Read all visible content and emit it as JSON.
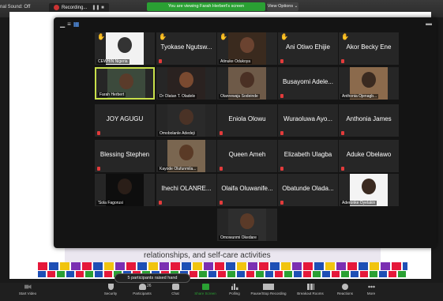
{
  "top": {
    "audio": "nal Sound: Off",
    "recording": "Recording...",
    "recording_controls": "❚❚ ■",
    "viewing_banner": "You are viewing Farah Herbert's screen",
    "view_options": "View Options ⌄"
  },
  "slide": {
    "text": "relationships, and self-care activities"
  },
  "participants": [
    {
      "name": "CEWHIN Nigeria",
      "hand": true,
      "video": true
    },
    {
      "name": "Tyokase Ngutsw...",
      "hand": true,
      "video": false
    },
    {
      "name": "Atinuke Odukoya",
      "hand": true,
      "video": true
    },
    {
      "name": "Ani Otiwo Ehijie",
      "hand": true,
      "video": false
    },
    {
      "name": "Akor Becky Ene",
      "hand": true,
      "video": false
    },
    {
      "name": "Farah Herbert",
      "hand": false,
      "video": true
    },
    {
      "name": "Dr Olatan T. Oladele",
      "hand": false,
      "video": true
    },
    {
      "name": "Olanrewaju Sodeinde",
      "hand": false,
      "video": true
    },
    {
      "name": "Busayomi Adele...",
      "hand": false,
      "video": false
    },
    {
      "name": "Anthonia Ojenagb...",
      "hand": false,
      "video": true
    },
    {
      "name": "JOY AGUGU",
      "hand": false,
      "video": false
    },
    {
      "name": "Omobolanle Adedeji",
      "hand": false,
      "video": true
    },
    {
      "name": "Eniola Olowu",
      "hand": false,
      "video": false
    },
    {
      "name": "Wuraoluwa Ayo...",
      "hand": false,
      "video": false
    },
    {
      "name": "Anthonia James",
      "hand": false,
      "video": false
    },
    {
      "name": "Blessing Stephen",
      "hand": false,
      "video": false
    },
    {
      "name": "Kayode Olufunmila...",
      "hand": false,
      "video": true
    },
    {
      "name": "Queen Ameh",
      "hand": false,
      "video": false
    },
    {
      "name": "Elizabeth Ulagba",
      "hand": false,
      "video": false
    },
    {
      "name": "Aduke Obelawo",
      "hand": false,
      "video": false
    },
    {
      "name": "'Sola Fagorusi",
      "hand": false,
      "video": true
    },
    {
      "name": "Ihechi OLANRE...",
      "hand": false,
      "video": false
    },
    {
      "name": "Olaifa Oluwanife...",
      "hand": false,
      "video": false
    },
    {
      "name": "Obatunde Olada...",
      "hand": false,
      "video": false
    },
    {
      "name": "Aderonke Oyelakin",
      "hand": false,
      "video": true
    },
    {
      "name": "Omowunmi Okedare",
      "hand": false,
      "video": true
    }
  ],
  "raised_notice": "5 participants raised hand",
  "toolbar": {
    "start_video": "Start Video",
    "security": "Security",
    "participants": "Participants",
    "participants_count": "26",
    "chat": "Chat",
    "share_screen": "Share Screen",
    "polling": "Polling",
    "recording": "Pause/Stop Recording",
    "breakout": "Breakout Rooms",
    "reactions": "Reactions",
    "more": "More"
  },
  "colors": {
    "accent_green": "#2aa033",
    "active_speaker": "#c8e04a",
    "muted_red": "#e23b3b",
    "hand_yellow": "#f5c242"
  }
}
